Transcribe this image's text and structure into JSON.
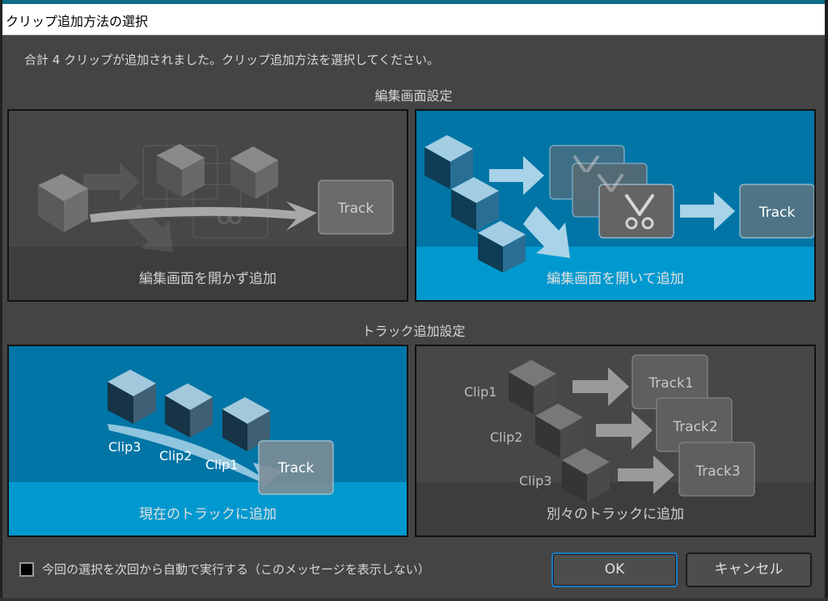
{
  "window": {
    "title": "クリップ追加方法の選択"
  },
  "message": "合計 4 クリップが追加されました。クリップ追加方法を選択してください。",
  "sections": [
    {
      "title": "編集画面設定",
      "options": [
        {
          "label": "編集画面を開かず追加",
          "selected": false,
          "track_label": "Track"
        },
        {
          "label": "編集画面を開いて追加",
          "selected": true,
          "track_label": "Track"
        }
      ]
    },
    {
      "title": "トラック追加設定",
      "options": [
        {
          "label": "現在のトラックに追加",
          "selected": true,
          "track_label": "Track",
          "clips": [
            "Clip3",
            "Clip2",
            "Clip1"
          ]
        },
        {
          "label": "別々のトラックに追加",
          "selected": false,
          "clips": [
            "Clip1",
            "Clip2",
            "Clip3"
          ],
          "tracks": [
            "Track1",
            "Track2",
            "Track3"
          ]
        }
      ]
    }
  ],
  "remember_checkbox": {
    "label": "今回の選択を次回から自動で実行する（このメッセージを表示しない）",
    "checked": false
  },
  "buttons": {
    "ok": "OK",
    "cancel": "キャンセル"
  },
  "colors": {
    "accent_blue": "#0075a6",
    "selected_band": "#0099cf",
    "focus_border": "#1a7cc4"
  }
}
